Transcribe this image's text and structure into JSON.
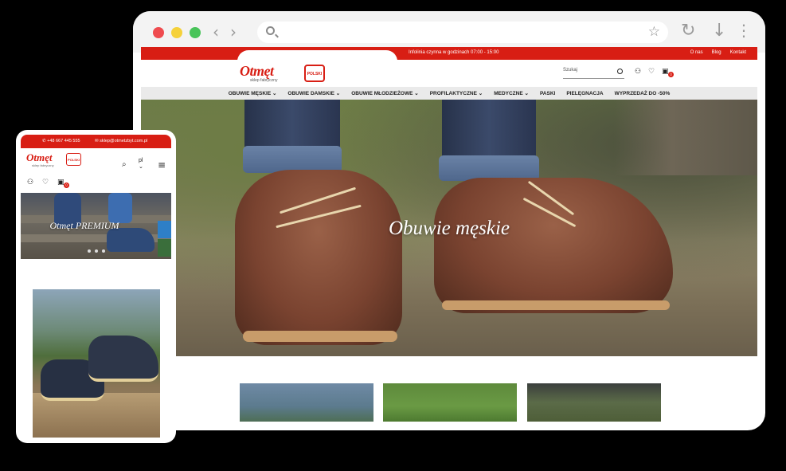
{
  "desktop": {
    "site": {
      "topbar": {
        "phone": "+48 667 445 555",
        "email": "sklep@otmetzbyt.com.pl",
        "hours": "Infolinia czynna w godzinach 07:00 - 15:00",
        "links": [
          "O nas",
          "Blog",
          "Kontakt"
        ]
      },
      "logo": "Otmęt",
      "logo_sub": "sklep fabryczny",
      "badge": "POLSKI",
      "search_placeholder": "Szukaj",
      "cart_count": "0",
      "menu": [
        "OBUWIE MĘSKIE ⌄",
        "OBUWIE DAMSKIE ⌄",
        "OBUWIE MŁODZIEŻOWE ⌄",
        "PROFILAKTYCZNE ⌄",
        "MEDYCZNE ⌄",
        "PASKI",
        "PIELĘGNACJA",
        "WYPRZEDAŻ DO -50%"
      ],
      "hero_title": "Obuwie męskie"
    }
  },
  "mobile": {
    "topbar": {
      "phone": "+48 667 445 555",
      "email": "sklep@otmetzbyt.com.pl"
    },
    "logo": "Otmęt",
    "logo_sub": "sklep fabryczny",
    "badge": "POLSKI",
    "lang": "pl",
    "cart_count": "0",
    "hero_title": "Otmęt PREMIUM"
  },
  "icons": {
    "search": "search-icon",
    "star": "bookmark-star-icon",
    "reload": "reload-icon",
    "download": "download-icon",
    "menu": "kebab-menu-icon",
    "user": "user-icon",
    "heart": "heart-icon",
    "cart": "cart-icon",
    "hamburger": "hamburger-icon"
  },
  "colors": {
    "brand_red": "#d81e14",
    "traffic_red": "#ef4b4f",
    "traffic_yellow": "#f5d13a",
    "traffic_green": "#49c45a"
  }
}
